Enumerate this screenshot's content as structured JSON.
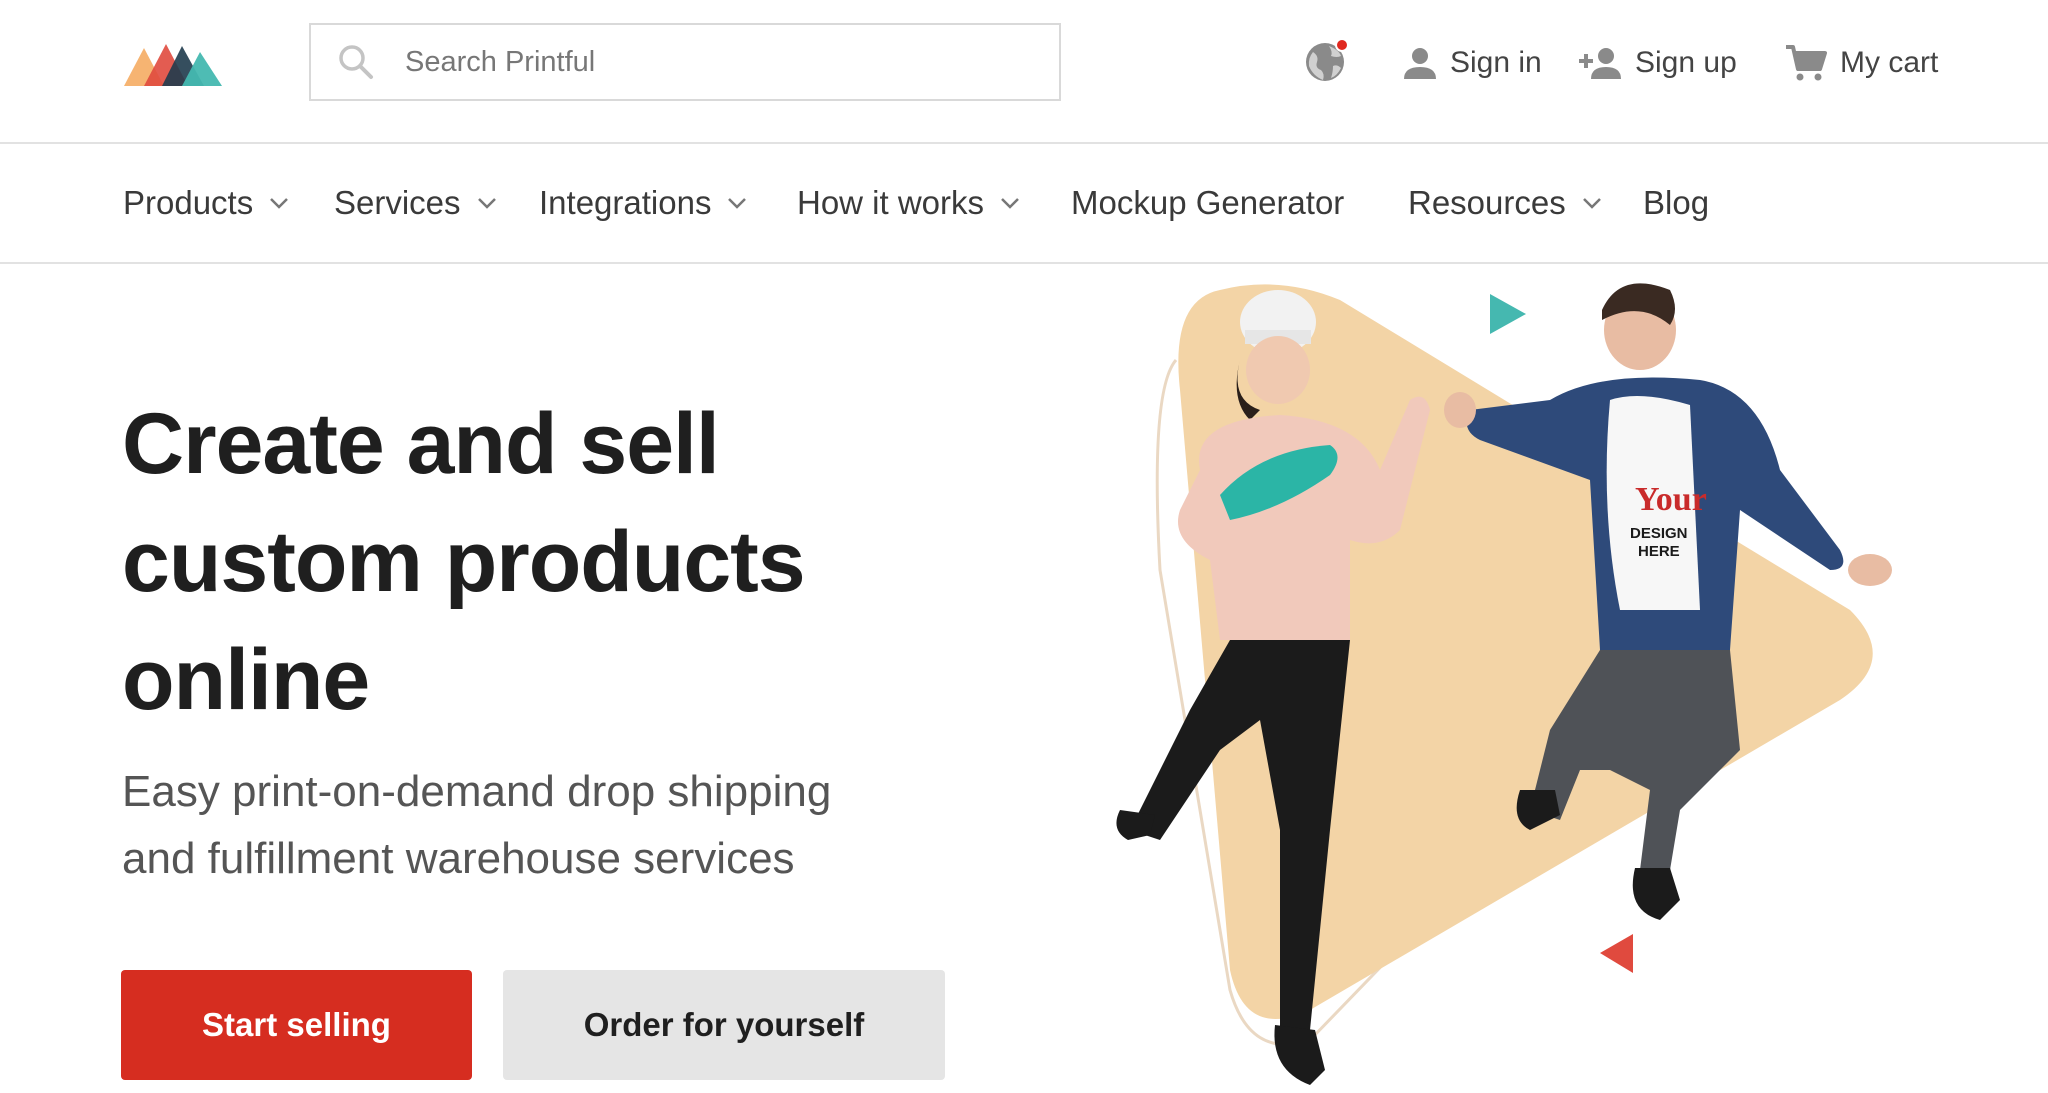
{
  "header": {
    "search_placeholder": "Search Printful",
    "sign_in": "Sign in",
    "sign_up": "Sign up",
    "cart": "My cart"
  },
  "nav": {
    "items": [
      {
        "label": "Products",
        "dropdown": true
      },
      {
        "label": "Services",
        "dropdown": true
      },
      {
        "label": "Integrations",
        "dropdown": true
      },
      {
        "label": "How it works",
        "dropdown": true
      },
      {
        "label": "Mockup Generator",
        "dropdown": false
      },
      {
        "label": "Resources",
        "dropdown": true
      },
      {
        "label": "Blog",
        "dropdown": false
      }
    ]
  },
  "hero": {
    "title_line1": "Create and sell",
    "title_line2": "custom products",
    "title_line3": "online",
    "subtitle_line1": "Easy print-on-demand drop shipping",
    "subtitle_line2": "and fulfillment warehouse services",
    "primary_cta": "Start selling",
    "secondary_cta": "Order for yourself",
    "image_design_text_1": "Your",
    "image_design_text_2": "DESIGN",
    "image_design_text_3": "HERE"
  },
  "colors": {
    "brand_red": "#d62d20",
    "accent_teal": "#45b8b0",
    "accent_peach": "#f3d4a6",
    "logo_orange": "#f5a85c",
    "logo_red": "#e0403a",
    "logo_dark": "#1f3b4d"
  },
  "icons": [
    "printful-logo",
    "search-icon",
    "globe-icon",
    "user-icon",
    "add-user-icon",
    "cart-icon",
    "chevron-down-icon"
  ]
}
